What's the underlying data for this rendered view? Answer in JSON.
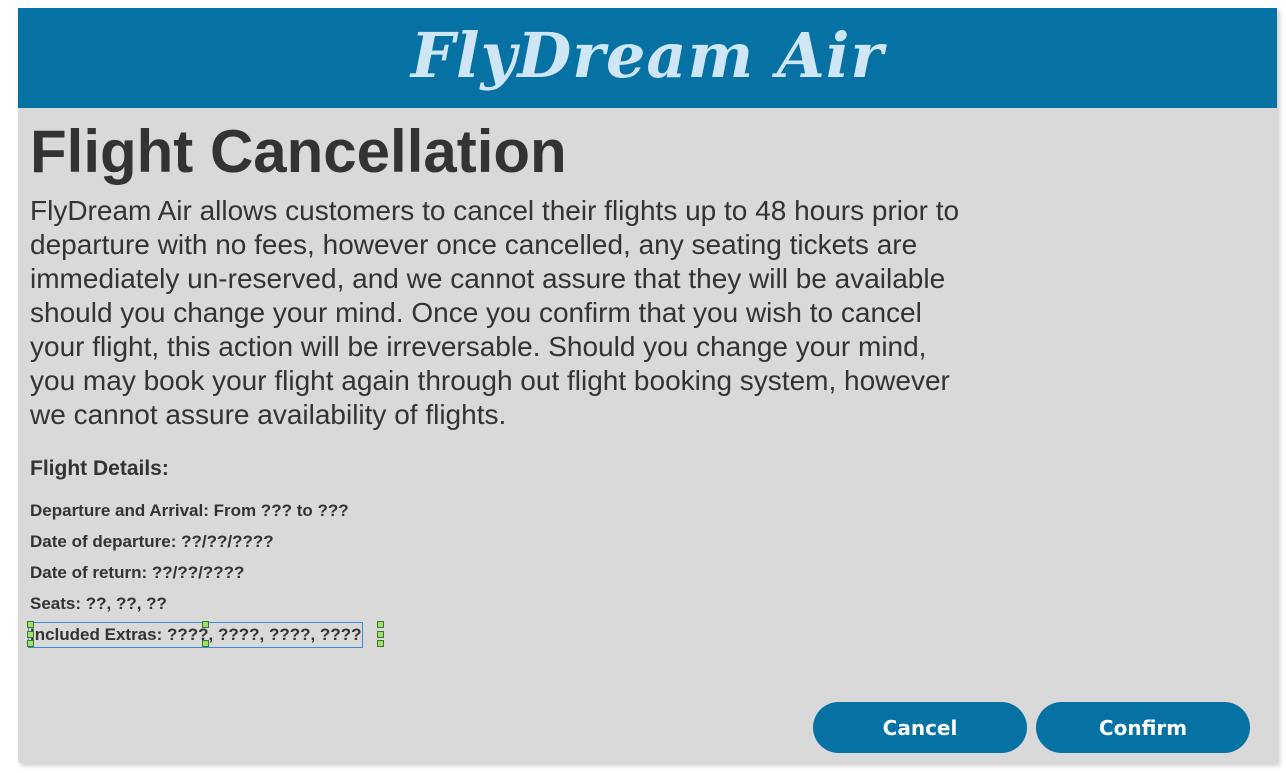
{
  "header": {
    "logo_text": "FlyDream Air"
  },
  "page": {
    "title": "Flight Cancellation",
    "intro": "FlyDream Air allows customers to cancel their flights up to 48 hours prior to departure with no fees, however once cancelled, any seating tickets are immediately un-reserved, and we cannot assure that they will be available should you change your mind. Once you confirm that you wish to cancel your flight, this action will be irreversable. Should you change your mind, you may book your flight again through out flight booking system, however we cannot assure availability of flights."
  },
  "details": {
    "heading": "Flight Details:",
    "departure_arrival": "Departure and Arrival: From ??? to ???",
    "date_departure": "Date of departure: ??/??/????",
    "date_return": "Date of return: ??/??/????",
    "seats": "Seats: ??, ??, ??",
    "extras": "Included Extras: ????, ????, ????, ????"
  },
  "actions": {
    "cancel_label": "Cancel",
    "confirm_label": "Confirm"
  },
  "colors": {
    "brand": "#0671a3",
    "logo": "#cfe6f7",
    "background": "#d9d9d9",
    "text": "#333333"
  }
}
